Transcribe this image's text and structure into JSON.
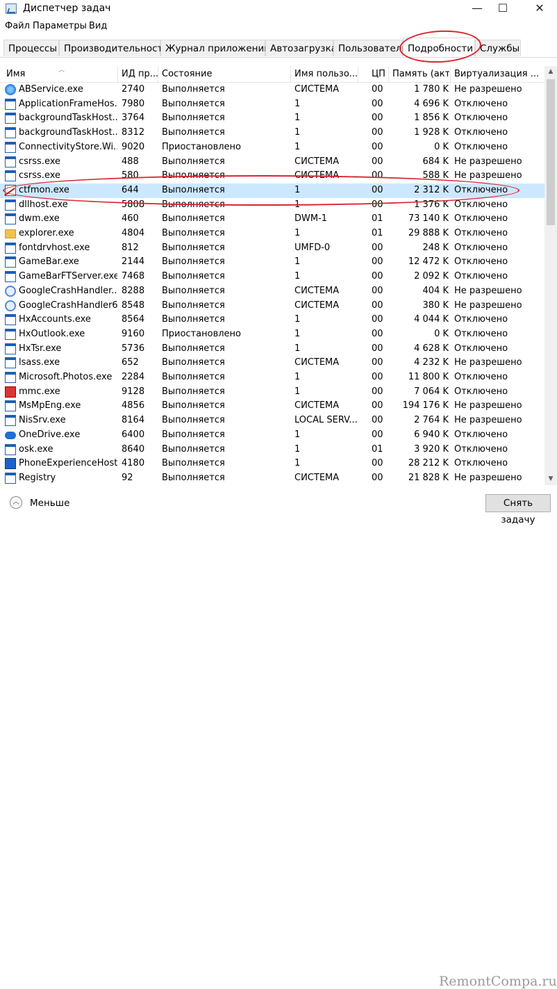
{
  "window": {
    "title": "Диспетчер задач",
    "controls": {
      "minimize": "—",
      "maximize": "☐",
      "close": "✕"
    }
  },
  "menu": [
    "Файл",
    "Параметры",
    "Вид"
  ],
  "tabs": [
    {
      "label": "Процессы",
      "active": false
    },
    {
      "label": "Производительность",
      "active": false
    },
    {
      "label": "Журнал приложений",
      "active": false
    },
    {
      "label": "Автозагрузка",
      "active": false
    },
    {
      "label": "Пользователи",
      "active": false
    },
    {
      "label": "Подробности",
      "active": true
    },
    {
      "label": "Службы",
      "active": false
    }
  ],
  "columns": {
    "name": "Имя",
    "pid": "ИД пр...",
    "status": "Состояние",
    "user": "Имя пользо...",
    "cpu": "ЦП",
    "memory": "Память (акт...",
    "virtualization": "Виртуализация ..."
  },
  "rows": [
    {
      "name": "ABService.exe",
      "pid": "2740",
      "status": "Выполняется",
      "user": "СИСТЕМА",
      "cpu": "00",
      "memory": "1 780 K",
      "virt": "Не разрешено",
      "icon": "blue-flower"
    },
    {
      "name": "ApplicationFrameHos...",
      "pid": "7980",
      "status": "Выполняется",
      "user": "1",
      "cpu": "00",
      "memory": "4 696 K",
      "virt": "Отключено",
      "icon": "window"
    },
    {
      "name": "backgroundTaskHost....",
      "pid": "3764",
      "status": "Выполняется",
      "user": "1",
      "cpu": "00",
      "memory": "1 856 K",
      "virt": "Отключено",
      "icon": "window"
    },
    {
      "name": "backgroundTaskHost....",
      "pid": "8312",
      "status": "Выполняется",
      "user": "1",
      "cpu": "00",
      "memory": "1 928 K",
      "virt": "Отключено",
      "icon": "window"
    },
    {
      "name": "ConnectivityStore.Wi...",
      "pid": "9020",
      "status": "Приостановлено",
      "user": "1",
      "cpu": "00",
      "memory": "0 K",
      "virt": "Отключено",
      "icon": "window"
    },
    {
      "name": "csrss.exe",
      "pid": "488",
      "status": "Выполняется",
      "user": "СИСТЕМА",
      "cpu": "00",
      "memory": "684 K",
      "virt": "Не разрешено",
      "icon": "window"
    },
    {
      "name": "csrss.exe",
      "pid": "580",
      "status": "Выполняется",
      "user": "СИСТЕМА",
      "cpu": "00",
      "memory": "588 K",
      "virt": "Не разрешено",
      "icon": "window"
    },
    {
      "name": "ctfmon.exe",
      "pid": "644",
      "status": "Выполняется",
      "user": "1",
      "cpu": "00",
      "memory": "2 312 K",
      "virt": "Отключено",
      "icon": "ctf",
      "selected": true
    },
    {
      "name": "dllhost.exe",
      "pid": "5808",
      "status": "Выполняется",
      "user": "1",
      "cpu": "00",
      "memory": "1 376 K",
      "virt": "Отключено",
      "icon": "window"
    },
    {
      "name": "dwm.exe",
      "pid": "460",
      "status": "Выполняется",
      "user": "DWM-1",
      "cpu": "01",
      "memory": "73 140 K",
      "virt": "Отключено",
      "icon": "window"
    },
    {
      "name": "explorer.exe",
      "pid": "4804",
      "status": "Выполняется",
      "user": "1",
      "cpu": "01",
      "memory": "29 888 K",
      "virt": "Отключено",
      "icon": "folder"
    },
    {
      "name": "fontdrvhost.exe",
      "pid": "812",
      "status": "Выполняется",
      "user": "UMFD-0",
      "cpu": "00",
      "memory": "248 K",
      "virt": "Отключено",
      "icon": "window"
    },
    {
      "name": "GameBar.exe",
      "pid": "2144",
      "status": "Выполняется",
      "user": "1",
      "cpu": "00",
      "memory": "12 472 K",
      "virt": "Отключено",
      "icon": "window"
    },
    {
      "name": "GameBarFTServer.exe",
      "pid": "7468",
      "status": "Выполняется",
      "user": "1",
      "cpu": "00",
      "memory": "2 092 K",
      "virt": "Отключено",
      "icon": "window"
    },
    {
      "name": "GoogleCrashHandler....",
      "pid": "8288",
      "status": "Выполняется",
      "user": "СИСТЕМА",
      "cpu": "00",
      "memory": "404 K",
      "virt": "Не разрешено",
      "icon": "google"
    },
    {
      "name": "GoogleCrashHandler6...",
      "pid": "8548",
      "status": "Выполняется",
      "user": "СИСТЕМА",
      "cpu": "00",
      "memory": "380 K",
      "virt": "Не разрешено",
      "icon": "google"
    },
    {
      "name": "HxAccounts.exe",
      "pid": "8564",
      "status": "Выполняется",
      "user": "1",
      "cpu": "00",
      "memory": "4 044 K",
      "virt": "Отключено",
      "icon": "window"
    },
    {
      "name": "HxOutlook.exe",
      "pid": "9160",
      "status": "Приостановлено",
      "user": "1",
      "cpu": "00",
      "memory": "0 K",
      "virt": "Отключено",
      "icon": "window"
    },
    {
      "name": "HxTsr.exe",
      "pid": "5736",
      "status": "Выполняется",
      "user": "1",
      "cpu": "00",
      "memory": "4 628 K",
      "virt": "Отключено",
      "icon": "window"
    },
    {
      "name": "lsass.exe",
      "pid": "652",
      "status": "Выполняется",
      "user": "СИСТЕМА",
      "cpu": "00",
      "memory": "4 232 K",
      "virt": "Не разрешено",
      "icon": "window"
    },
    {
      "name": "Microsoft.Photos.exe",
      "pid": "2284",
      "status": "Выполняется",
      "user": "1",
      "cpu": "00",
      "memory": "11 800 K",
      "virt": "Отключено",
      "icon": "window"
    },
    {
      "name": "mmc.exe",
      "pid": "9128",
      "status": "Выполняется",
      "user": "1",
      "cpu": "00",
      "memory": "7 064 K",
      "virt": "Отключено",
      "icon": "red"
    },
    {
      "name": "MsMpEng.exe",
      "pid": "4856",
      "status": "Выполняется",
      "user": "СИСТЕМА",
      "cpu": "00",
      "memory": "194 176 K",
      "virt": "Не разрешено",
      "icon": "window"
    },
    {
      "name": "NisSrv.exe",
      "pid": "8164",
      "status": "Выполняется",
      "user": "LOCAL SERV...",
      "cpu": "00",
      "memory": "2 764 K",
      "virt": "Не разрешено",
      "icon": "window"
    },
    {
      "name": "OneDrive.exe",
      "pid": "6400",
      "status": "Выполняется",
      "user": "1",
      "cpu": "00",
      "memory": "6 940 K",
      "virt": "Отключено",
      "icon": "cloud"
    },
    {
      "name": "osk.exe",
      "pid": "8640",
      "status": "Выполняется",
      "user": "1",
      "cpu": "01",
      "memory": "3 920 K",
      "virt": "Отключено",
      "icon": "window"
    },
    {
      "name": "PhoneExperienceHost...",
      "pid": "4180",
      "status": "Выполняется",
      "user": "1",
      "cpu": "00",
      "memory": "28 212 K",
      "virt": "Отключено",
      "icon": "phone"
    },
    {
      "name": "Registry",
      "pid": "92",
      "status": "Выполняется",
      "user": "СИСТЕМА",
      "cpu": "00",
      "memory": "21 828 K",
      "virt": "Не разрешено",
      "icon": "window"
    }
  ],
  "footer": {
    "less_label": "Меньше",
    "end_task_label": "Снять задачу",
    "watermark": "RemontCompa.ru"
  },
  "colors": {
    "annotation": "#d9262e",
    "selected_row": "#cce8ff"
  }
}
